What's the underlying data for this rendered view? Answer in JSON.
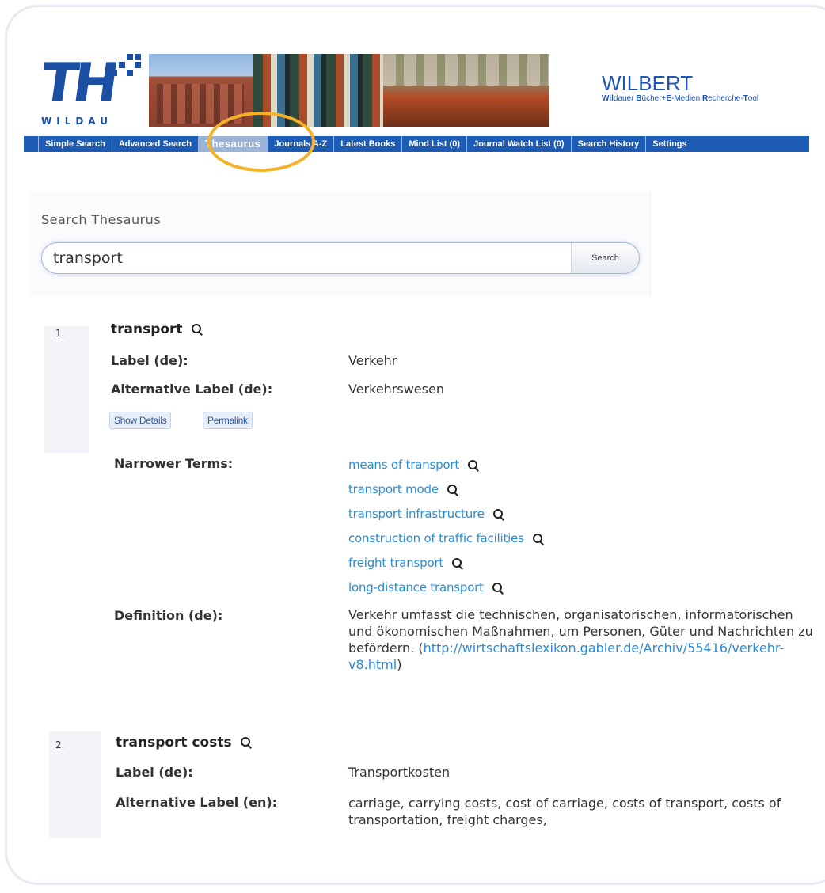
{
  "header": {
    "logo_text": "TH",
    "logo_subtext": "WILDAU",
    "brand_title": "WILBERT",
    "brand_subtitle_parts": [
      "Wil",
      "dauer ",
      "B",
      "ücher+",
      "E",
      "-Medien ",
      "R",
      "echerche-",
      "T",
      "ool"
    ]
  },
  "nav": {
    "items": [
      {
        "label": "Simple Search"
      },
      {
        "label": "Advanced Search"
      },
      {
        "label": "Thesaurus"
      },
      {
        "label": "Journals A-Z"
      },
      {
        "label": "Latest Books"
      },
      {
        "label": "Mind List (0)"
      },
      {
        "label": "Journal Watch List (0)"
      },
      {
        "label": "Search History"
      },
      {
        "label": "Settings"
      }
    ],
    "active": "Thesaurus"
  },
  "search": {
    "heading": "Search Thesaurus",
    "value": "transport",
    "button_label": "Search"
  },
  "results": [
    {
      "number": "1.",
      "term": "transport",
      "label_de_label": "Label (de):",
      "label_de": "Verkehr",
      "alt_label_label": "Alternative Label (de):",
      "alt_label": "Verkehrswesen",
      "show_details": "Show Details",
      "permalink": "Permalink",
      "narrower_label": "Narrower Terms:",
      "narrower_terms": [
        "means of transport",
        "transport mode",
        "transport infrastructure",
        "construction of traffic facilities",
        "freight transport",
        "long-distance transport"
      ],
      "definition_label": "Definition (de):",
      "definition_text": "Verkehr umfasst die technischen, organisatorischen, informatorischen und ökonomischen Maßnahmen, um Personen, Güter und Nachrichten zu befördern.",
      "definition_open": "(",
      "definition_link": "http://wirtschaftslexikon.gabler.de/Archiv/55416/verkehr-v8.html",
      "definition_close": ")"
    },
    {
      "number": "2.",
      "term": "transport costs",
      "label_de_label": "Label (de):",
      "label_de": "Transportkosten",
      "alt_label_label": "Alternative Label (en):",
      "alt_label": "carriage, carrying costs, cost of carriage, costs of transport, costs of transportation, freight charges,"
    }
  ],
  "colors": {
    "nav_bg": "#1d5bb5",
    "brand_blue": "#1d56b6",
    "link_blue": "#2b8bd8",
    "highlight_ring": "#f3b228"
  }
}
